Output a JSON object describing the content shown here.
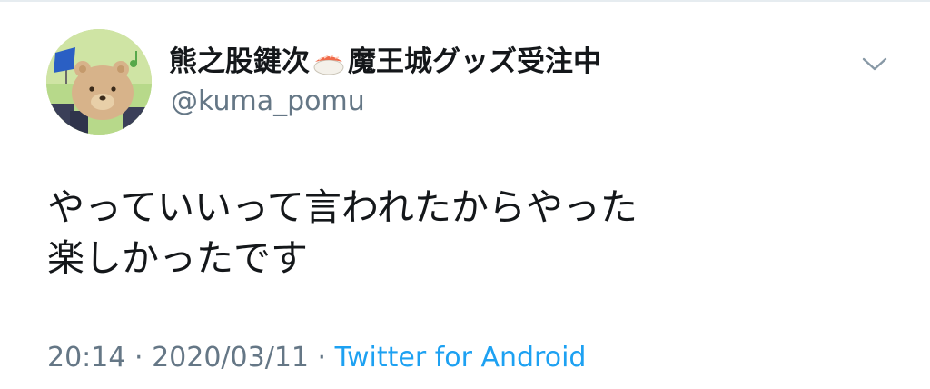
{
  "author": {
    "display_name": "熊之股鍵次",
    "display_name_suffix": "魔王城グッズ受注中",
    "handle": "@kuma_pomu",
    "avatar_icon": "bear-avatar-icon",
    "name_emoji_icon": "sushi-icon"
  },
  "tweet": {
    "lines": [
      "やっていいって言われたからやった",
      "楽しかったです"
    ]
  },
  "meta": {
    "time": "20:14",
    "separator": " · ",
    "date": "2020/03/11",
    "source": "Twitter for Android"
  },
  "colors": {
    "text": "#14171a",
    "secondary": "#657786",
    "link": "#1da1f2"
  }
}
